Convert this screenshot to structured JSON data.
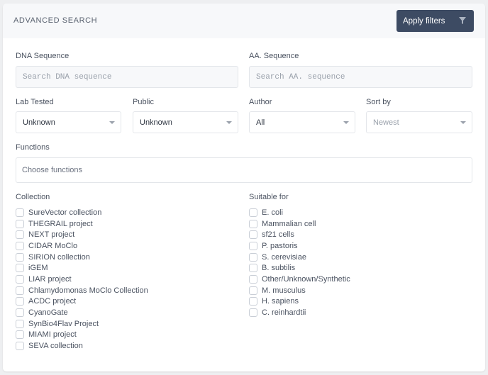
{
  "header": {
    "title": "ADVANCED SEARCH",
    "apply_label": "Apply filters",
    "apply_icon": "filter-icon"
  },
  "dna": {
    "label": "DNA Sequence",
    "placeholder": "Search DNA sequence",
    "value": ""
  },
  "aa": {
    "label": "AA. Sequence",
    "placeholder": "Search AA. sequence",
    "value": ""
  },
  "lab_tested": {
    "label": "Lab Tested",
    "selected": "Unknown"
  },
  "public": {
    "label": "Public",
    "selected": "Unknown"
  },
  "author": {
    "label": "Author",
    "selected": "All"
  },
  "sort_by": {
    "label": "Sort by",
    "selected": "Newest"
  },
  "functions": {
    "label": "Functions",
    "placeholder": "Choose functions"
  },
  "collection": {
    "label": "Collection",
    "items": [
      {
        "label": "SureVector collection",
        "checked": false
      },
      {
        "label": "THEGRAIL project",
        "checked": false
      },
      {
        "label": "NEXT project",
        "checked": false
      },
      {
        "label": "CIDAR MoClo",
        "checked": false
      },
      {
        "label": "SIRION collection",
        "checked": false
      },
      {
        "label": "iGEM",
        "checked": false
      },
      {
        "label": "LIAR project",
        "checked": false
      },
      {
        "label": "Chlamydomonas MoClo Collection",
        "checked": false
      },
      {
        "label": "ACDC project",
        "checked": false
      },
      {
        "label": "CyanoGate",
        "checked": false
      },
      {
        "label": "SynBio4Flav Project",
        "checked": false
      },
      {
        "label": "MIAMI project",
        "checked": false
      },
      {
        "label": "SEVA collection",
        "checked": false
      }
    ]
  },
  "suitable_for": {
    "label": "Suitable for",
    "items": [
      {
        "label": "E. coli",
        "checked": false
      },
      {
        "label": "Mammalian cell",
        "checked": false
      },
      {
        "label": "sf21 cells",
        "checked": false
      },
      {
        "label": "P. pastoris",
        "checked": false
      },
      {
        "label": "S. cerevisiae",
        "checked": false
      },
      {
        "label": "B. subtilis",
        "checked": false
      },
      {
        "label": "Other/Unknown/Synthetic",
        "checked": false
      },
      {
        "label": "M. musculus",
        "checked": false
      },
      {
        "label": "H. sapiens",
        "checked": false
      },
      {
        "label": "C. reinhardtii",
        "checked": false
      }
    ]
  },
  "colors": {
    "primary_button": "#3d4b63",
    "header_bg": "#f7f8fa",
    "page_bg": "#eeeff1"
  }
}
